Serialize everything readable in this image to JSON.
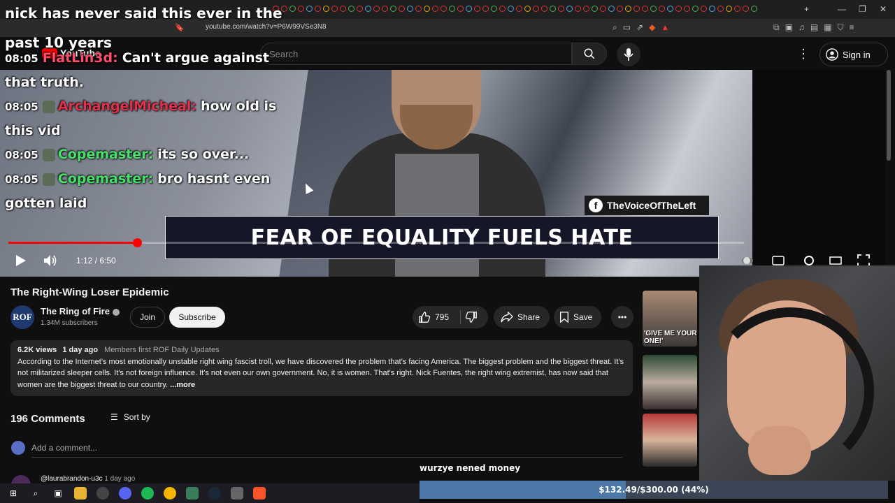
{
  "browser": {
    "url": "youtube.com/watch?v=P6W99VSe3N8",
    "tab_count_hint": "many"
  },
  "header": {
    "logo_text": "YouTube",
    "search_placeholder": "Search",
    "signin_label": "Sign in"
  },
  "overlay": {
    "top_caption": "nick has never said this ever in the past 10 years",
    "chat": [
      {
        "time": "08:05",
        "user": "FlatLin3d:",
        "user_color": "#ff4d6d",
        "message": "Can't argue against that truth.",
        "emote": false
      },
      {
        "time": "08:05",
        "user": "ArchangelMicheal:",
        "user_color": "#e0304a",
        "message": "how old is this vid",
        "emote": true
      },
      {
        "time": "08:05",
        "user": "Copemaster:",
        "user_color": "#47e06a",
        "message": "its so over...",
        "emote": true
      },
      {
        "time": "08:05",
        "user": "Copemaster:",
        "user_color": "#47e06a",
        "message": "bro hasnt even gotten laid",
        "emote": true
      }
    ],
    "tts_text": "wurzye nened money",
    "goal": {
      "text": "$132.49/$300.00 (44%)",
      "fraction": 0.44
    }
  },
  "video": {
    "lower_third": "FEAR OF EQUALITY FUELS HATE",
    "fb_handle": "TheVoiceOfTheLeft",
    "time_display": "1:12 / 6:50",
    "progress_fraction": 0.175
  },
  "meta": {
    "title": "The Right-Wing Loser Epidemic",
    "channel_initials": "ROF",
    "channel_name": "The Ring of Fire",
    "subscribers": "1.34M subscribers",
    "join_label": "Join",
    "subscribe_label": "Subscribe",
    "likes": "795",
    "share_label": "Share",
    "save_label": "Save"
  },
  "description": {
    "views": "6.2K views",
    "age": "1 day ago",
    "tags": "Members first  ROF Daily Updates",
    "text": "According to the Internet's most emotionally unstable right wing fascist troll, we have discovered the problem that's facing America. The biggest problem and the biggest threat. It's not militarized sleeper cells. It's not foreign influence. It's not even our own government. No, it is women. That's right. Nick Fuentes, the right wing extremist, has now said that women are the biggest threat to our country.",
    "more_label": "...more"
  },
  "comments": {
    "count_label": "196 Comments",
    "sort_label": "Sort by",
    "add_placeholder": "Add a comment...",
    "first_user": "@laurabrandon-u3c",
    "first_age": "1 day ago"
  },
  "sidebar": {
    "thumb1_caption": "'GIVE ME YOUR ONE!'",
    "thumb2_caption": "",
    "thumb3_caption": ""
  }
}
